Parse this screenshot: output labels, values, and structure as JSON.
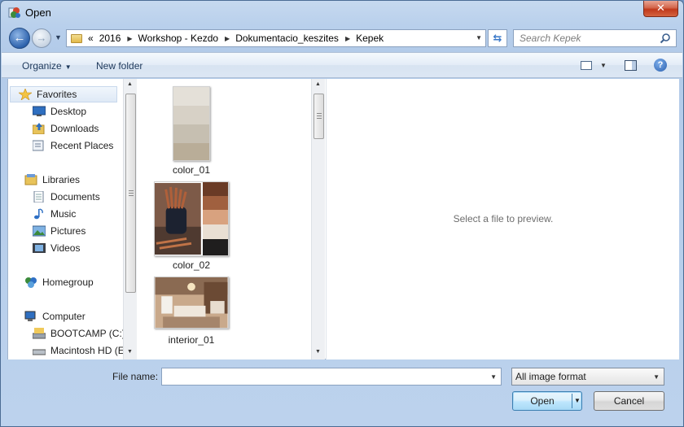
{
  "window": {
    "title": "Open",
    "close_label": "✕"
  },
  "nav": {
    "breadcrumbs": [
      "«",
      "2016",
      "Workshop - Kezdo",
      "Dokumentacio_keszites",
      "Kepek"
    ],
    "search_placeholder": "Search Kepek"
  },
  "toolbar": {
    "organize_label": "Organize",
    "new_folder_label": "New folder",
    "help_label": "?"
  },
  "sidebar": {
    "items": [
      {
        "label": "Favorites",
        "icon": "star-icon",
        "group": true
      },
      {
        "label": "Desktop",
        "icon": "desktop-icon"
      },
      {
        "label": "Downloads",
        "icon": "downloads-icon"
      },
      {
        "label": "Recent Places",
        "icon": "recent-places-icon"
      },
      {
        "label": "Libraries",
        "icon": "libraries-icon",
        "group": true
      },
      {
        "label": "Documents",
        "icon": "documents-icon"
      },
      {
        "label": "Music",
        "icon": "music-icon"
      },
      {
        "label": "Pictures",
        "icon": "pictures-icon"
      },
      {
        "label": "Videos",
        "icon": "videos-icon"
      },
      {
        "label": "Homegroup",
        "icon": "homegroup-icon",
        "group": true
      },
      {
        "label": "Computer",
        "icon": "computer-icon",
        "group": true
      },
      {
        "label": "BOOTCAMP (C:)",
        "icon": "drive-icon"
      },
      {
        "label": "Macintosh HD (E",
        "icon": "drive-icon"
      }
    ]
  },
  "files": [
    {
      "name": "color_01"
    },
    {
      "name": "color_02"
    },
    {
      "name": "interior_01"
    }
  ],
  "preview": {
    "message": "Select a file to preview."
  },
  "bottom": {
    "filename_label": "File name:",
    "filename_value": "",
    "filetype_value": "All image format",
    "open_label": "Open",
    "cancel_label": "Cancel"
  },
  "colors": {
    "frame": "#b9d0ec",
    "toolbar_text": "#1e395b",
    "selection": "#dfe9f6",
    "swatches_color01": [
      "#e4e0d8",
      "#d7d1c6",
      "#c6bfb1",
      "#b9ad98"
    ],
    "swatches_color02": [
      "#6a3b26",
      "#a0603f",
      "#d8a27f",
      "#e9dfd3",
      "#1f1e1e"
    ]
  }
}
